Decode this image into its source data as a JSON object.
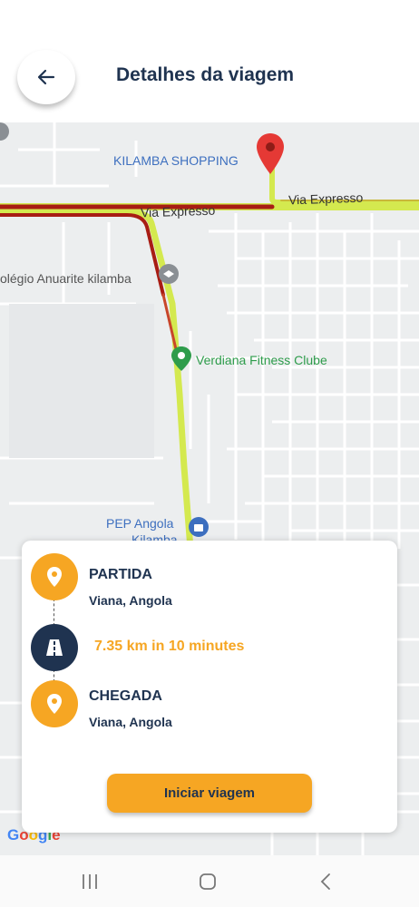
{
  "header": {
    "title": "Detalhes da viagem",
    "back_icon": "arrow-left-icon"
  },
  "map": {
    "labels": {
      "kilamba_shopping": "KILAMBA SHOPPING",
      "via_expresso_1": "Via Expresso",
      "via_expresso_2": "Via Expresso",
      "colegio": "olégio Anuarite kilamba",
      "verdiana": "Verdiana Fitness Clube",
      "pep_angola": "PEP Angola",
      "pep_sub": "Kilamba",
      "google": [
        "G",
        "o",
        "o",
        "g",
        "l",
        "e"
      ]
    },
    "colors": {
      "background": "#eceeef",
      "route": "#d4e94f",
      "traffic": "#a81d14",
      "pin": "#e53935",
      "poi_blue": "#3d6fbf",
      "poi_green": "#2e9c4b"
    }
  },
  "trip": {
    "departure_title": "PARTIDA",
    "departure_place": "Viana, Angola",
    "distance_text": "7.35 km in 10 minutes",
    "arrival_title": "CHEGADA",
    "arrival_place": "Viana, Angola",
    "start_button": "Iniciar viagem",
    "icons": [
      "location-pin-icon",
      "road-icon",
      "location-pin-icon"
    ]
  },
  "colors": {
    "accent": "#f6a623",
    "navy": "#1f3350"
  },
  "navbar": {
    "icons": [
      "recent-apps-icon",
      "home-icon",
      "back-icon"
    ]
  }
}
